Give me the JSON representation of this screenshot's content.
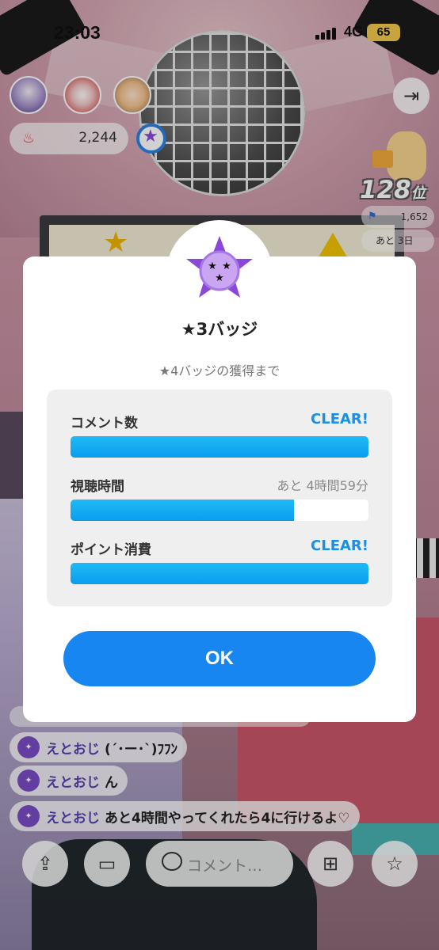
{
  "status_bar": {
    "time": "23:03",
    "network": "4G",
    "battery": "65"
  },
  "stream": {
    "points": "2,244",
    "rank": {
      "number": "128",
      "unit": "位"
    },
    "fans_count": "1,652",
    "days_left": "あと 3日"
  },
  "comments": [
    {
      "user": "えとおじ",
      "message": "(´･ー･`)ﾌﾌﾝ"
    },
    {
      "user": "えとおじ",
      "message": "ん"
    },
    {
      "user": "えとおじ",
      "message": "あと4時間やってくれたら4に行けるよ♡"
    }
  ],
  "toolbar": {
    "comment_placeholder": "コメント…"
  },
  "modal": {
    "title": "★3バッジ",
    "subtitle": "★4バッジの獲得まで",
    "badge_color": "#8b48d8",
    "rows": [
      {
        "label": "コメント数",
        "status": "CLEAR!",
        "progress": 1.0
      },
      {
        "label": "視聴時間",
        "status": "あと 4時間59分",
        "progress": 0.75
      },
      {
        "label": "ポイント消費",
        "status": "CLEAR!",
        "progress": 1.0
      }
    ],
    "ok_label": "OK",
    "accent_color": "#1786f0"
  }
}
